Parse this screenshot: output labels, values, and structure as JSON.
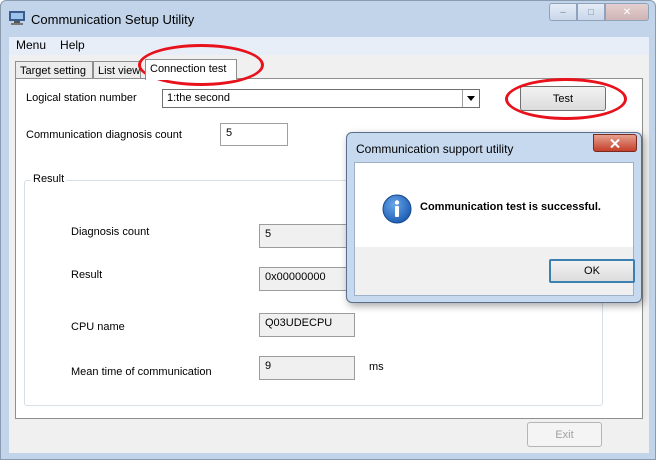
{
  "window": {
    "title": "Communication Setup Utility",
    "caption_minimize": "–",
    "caption_maximize": "□",
    "caption_close": "✕"
  },
  "menu": {
    "items": [
      "Menu",
      "Help"
    ]
  },
  "tabs": [
    {
      "label": "Target setting",
      "active": false
    },
    {
      "label": "List view",
      "active": false
    },
    {
      "label": "Connection test",
      "active": true
    }
  ],
  "connection_test": {
    "logical_station_label": "Logical station number",
    "logical_station_value": "1:the second",
    "test_button": "Test",
    "diag_count_label": "Communication diagnosis count",
    "diag_count_value": "5",
    "result_group_title": "Result",
    "fields": {
      "diagnosis_count": {
        "label": "Diagnosis count",
        "value": "5"
      },
      "result": {
        "label": "Result",
        "value": "0x00000000"
      },
      "cpu_name": {
        "label": "CPU name",
        "value": "Q03UDECPU"
      },
      "mean_time": {
        "label": "Mean time of communication",
        "value": "9",
        "unit": "ms"
      }
    }
  },
  "exit_button": "Exit",
  "dialog": {
    "title": "Communication support utility",
    "message": "Communication test is successful.",
    "ok_button": "OK",
    "icon": "info-icon"
  },
  "colors": {
    "annotation": "#e8121c",
    "titlebar": "#c2d4ea",
    "info_icon": "#1f5fb4"
  }
}
